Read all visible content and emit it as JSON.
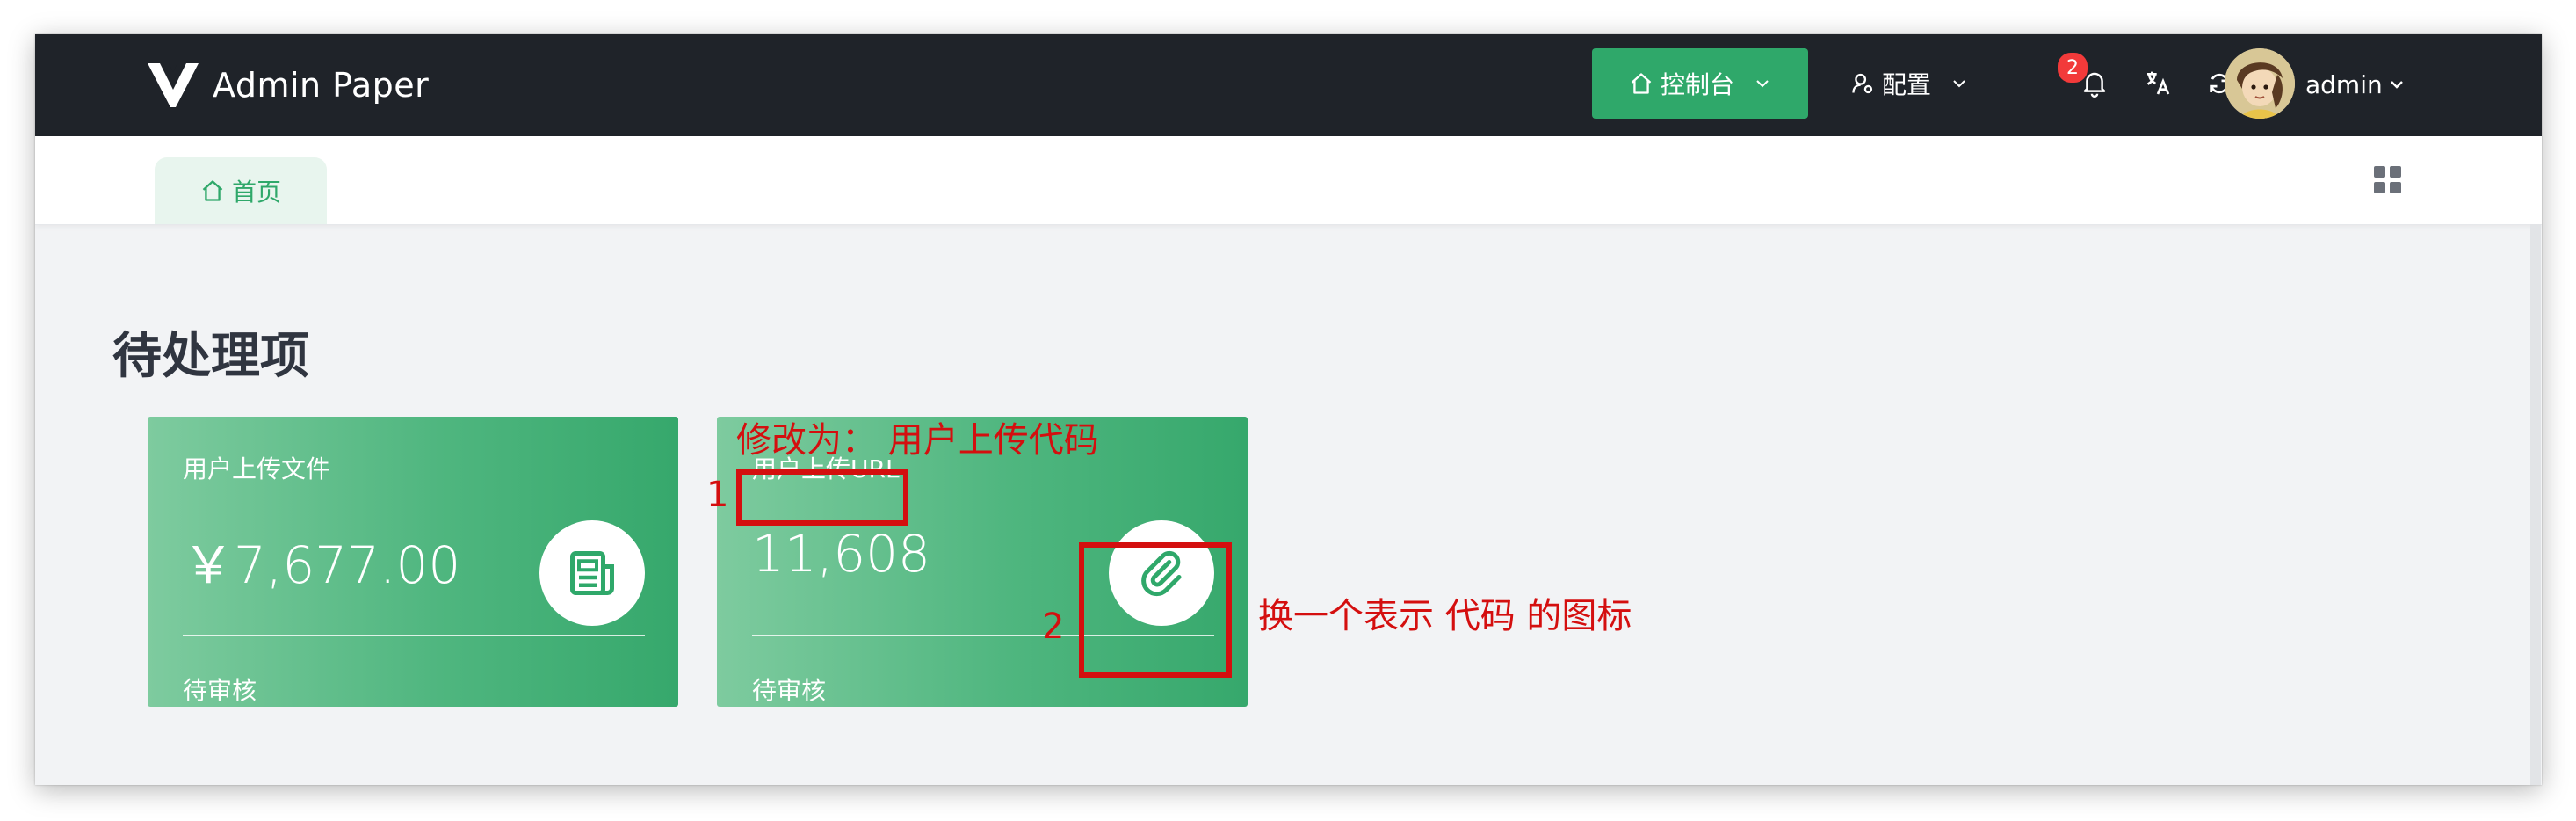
{
  "app": {
    "title": "Admin Paper"
  },
  "header": {
    "console_label": "控制台",
    "config_label": "配置",
    "notification_count": "2",
    "user_name": "admin"
  },
  "tabs": [
    {
      "label": "首页"
    }
  ],
  "main": {
    "section_title": "待处理项",
    "cards": [
      {
        "label": "用户上传文件",
        "value": "￥7,677.00",
        "footer": "待审核",
        "icon": "newspaper-icon"
      },
      {
        "label": "用户上传URL",
        "value": "11,608",
        "footer": "待审核",
        "icon": "paperclip-icon"
      }
    ]
  },
  "annotations": {
    "note1": "修改为：  用户上传代码",
    "marker1": "1",
    "marker2": "2",
    "note2": "换一个表示 代码 的图标"
  },
  "colors": {
    "header_bg": "#1f2329",
    "accent_green": "#2fa86a",
    "annotation_red": "#d40f0f",
    "badge_red": "#f23a3a"
  }
}
